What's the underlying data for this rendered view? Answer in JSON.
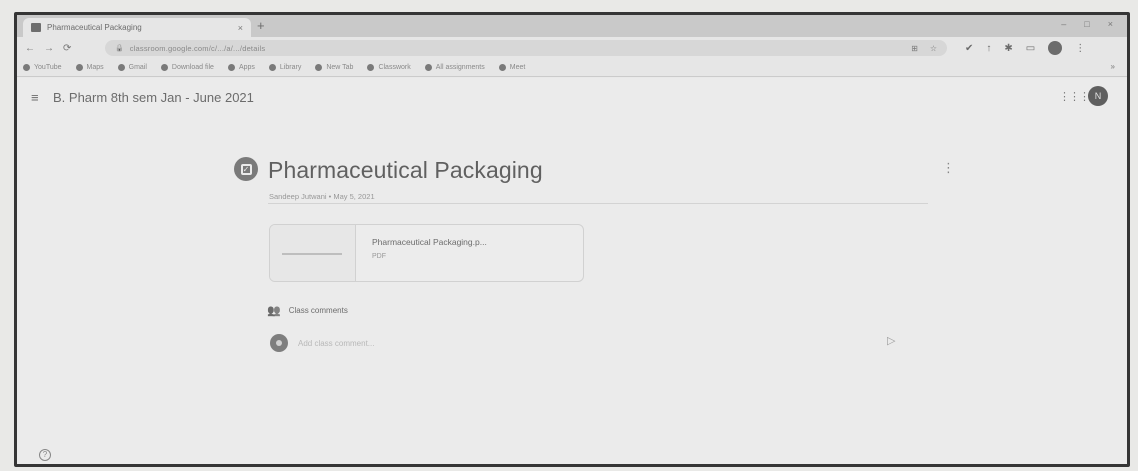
{
  "browser": {
    "tab_title": "Pharmaceutical Packaging",
    "tab_close": "×",
    "new_tab": "+",
    "window_controls": {
      "minimize": "–",
      "maximize": "□",
      "close": "×"
    },
    "nav": {
      "back": "←",
      "forward": "→",
      "reload": "⟳"
    },
    "url": "classroom.google.com/c/.../a/.../details",
    "bookmarks": [
      {
        "label": "YouTube",
        "icon": "youtube-icon"
      },
      {
        "label": "Maps",
        "icon": "maps-icon"
      },
      {
        "label": "Gmail",
        "icon": "gmail-icon"
      },
      {
        "label": "Download file",
        "icon": "download-icon"
      },
      {
        "label": "Apps",
        "icon": "apps-icon"
      },
      {
        "label": "Library",
        "icon": "library-icon"
      },
      {
        "label": "New Tab",
        "icon": "newtab-icon"
      },
      {
        "label": "Classwork",
        "icon": "classwork-icon"
      },
      {
        "label": "All assignments",
        "icon": "assignments-icon"
      },
      {
        "label": "Meet",
        "icon": "meet-icon"
      }
    ],
    "bookmarks_more": "»"
  },
  "classroom": {
    "menu_icon": "≡",
    "class_title": "B. Pharm 8th sem Jan - June 2021",
    "apps_icon": "⋮⋮⋮",
    "account_initial": "N",
    "post": {
      "title": "Pharmaceutical Packaging",
      "meta": "Sandeep Jutwani • May 5, 2021",
      "more_icon": "⋮",
      "attachment": {
        "name": "Pharmaceutical Packaging.p...",
        "type": "PDF"
      }
    },
    "comments": {
      "label": "Class comments",
      "placeholder": "Add class comment...",
      "send_icon": "▷"
    },
    "help_icon": "?"
  }
}
